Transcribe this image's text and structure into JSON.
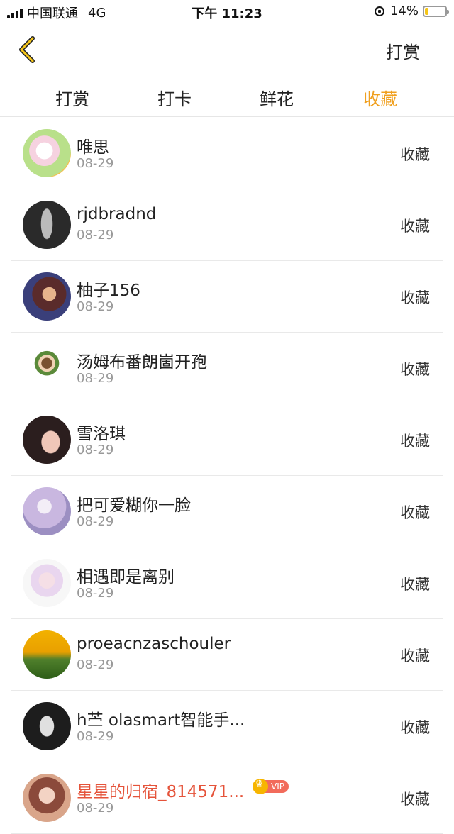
{
  "status_bar": {
    "carrier": "中国联通",
    "network": "4G",
    "time": "下午 11:23",
    "battery": "14%"
  },
  "nav": {
    "back_icon": "chevron-left-icon",
    "action_label": "打赏"
  },
  "tabs": [
    {
      "label": "打赏",
      "active": false
    },
    {
      "label": "打卡",
      "active": false
    },
    {
      "label": "鲜花",
      "active": false
    },
    {
      "label": "收藏",
      "active": true
    }
  ],
  "colors": {
    "accent": "#f0a020",
    "vip_name": "#e5533a"
  },
  "list": [
    {
      "name": "唯思",
      "date": "08-29",
      "action": "收藏",
      "vip": false
    },
    {
      "name": "rjdbradnd",
      "date": "08-29",
      "action": "收藏",
      "vip": false
    },
    {
      "name": "柚子156",
      "date": "08-29",
      "action": "收藏",
      "vip": false
    },
    {
      "name": "汤姆布番朗崮开孢",
      "date": "08-29",
      "action": "收藏",
      "vip": false
    },
    {
      "name": "雪洛琪",
      "date": "08-29",
      "action": "收藏",
      "vip": false
    },
    {
      "name": "把可爱糊你一脸",
      "date": "08-29",
      "action": "收藏",
      "vip": false
    },
    {
      "name": "相遇即是离别",
      "date": "08-29",
      "action": "收藏",
      "vip": false
    },
    {
      "name": "proeacnzaschouler",
      "date": "08-29",
      "action": "收藏",
      "vip": false
    },
    {
      "name": "h苎 olasmart智能手...",
      "date": "08-29",
      "action": "收藏",
      "vip": false
    },
    {
      "name": "星星的归宿_814571...",
      "date": "08-29",
      "action": "收藏",
      "vip": true,
      "badge": "VIP"
    }
  ]
}
